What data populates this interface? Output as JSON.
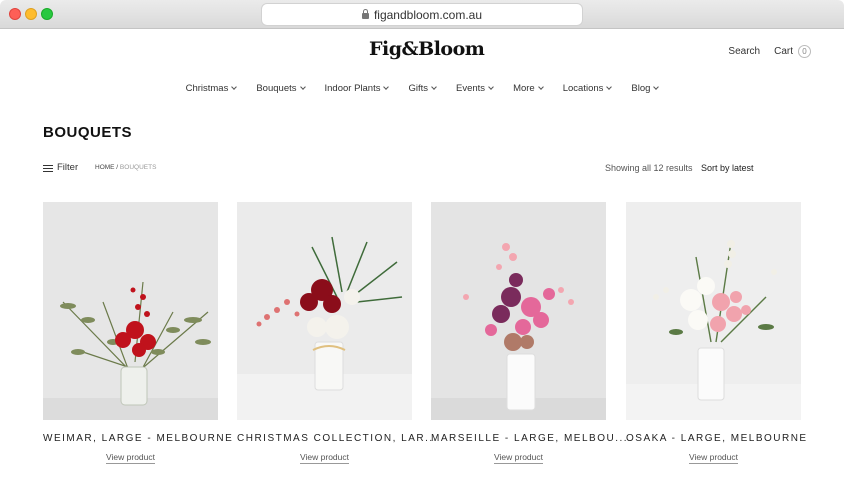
{
  "browser": {
    "url": "figandbloom.com.au"
  },
  "header": {
    "logo": "Fig&Bloom",
    "search": "Search",
    "cart": "Cart",
    "cart_count": "0"
  },
  "nav": [
    "Christmas",
    "Bouquets",
    "Indoor Plants",
    "Gifts",
    "Events",
    "More",
    "Locations",
    "Blog"
  ],
  "page": {
    "title": "BOUQUETS",
    "filter": "Filter",
    "breadcrumb_home": "HOME",
    "breadcrumb_sep": " / ",
    "breadcrumb_current": "BOUQUETS",
    "results": "Showing all 12 results",
    "sort": "Sort by latest"
  },
  "products": [
    {
      "name": "WEIMAR, LARGE - MELBOURNE",
      "link": "View product"
    },
    {
      "name": "CHRISTMAS COLLECTION, LAR...",
      "link": "View product"
    },
    {
      "name": "MARSEILLE - LARGE, MELBOU...",
      "link": "View product"
    },
    {
      "name": "OSAKA - LARGE, MELBOURNE",
      "link": "View product"
    }
  ]
}
